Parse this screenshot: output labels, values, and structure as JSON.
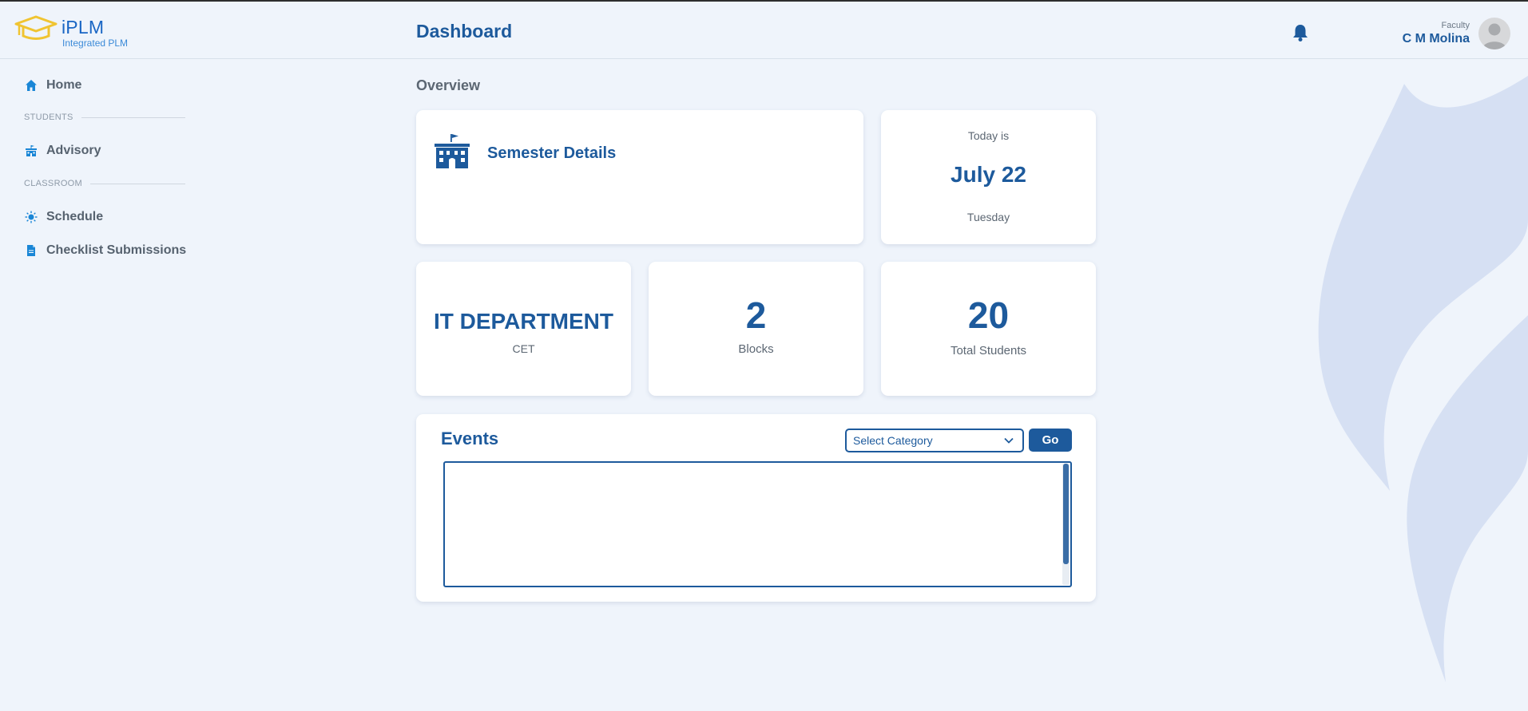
{
  "brand": {
    "name": "iPLM",
    "subtitle": "Integrated PLM"
  },
  "header": {
    "title": "Dashboard",
    "notifications_icon": "bell-icon",
    "user_role": "Faculty",
    "user_name": "C M Molina"
  },
  "sidebar": {
    "home": {
      "label": "Home",
      "icon": "home-icon"
    },
    "sections": [
      {
        "label": "STUDENTS"
      },
      {
        "label": "CLASSROOM"
      }
    ],
    "items": [
      {
        "label": "Advisory",
        "icon": "school-building-icon"
      },
      {
        "label": "Schedule",
        "icon": "bulb-icon"
      },
      {
        "label": "Checklist Submissions",
        "icon": "document-icon"
      }
    ]
  },
  "main": {
    "section_title": "Overview",
    "semester": {
      "title": "Semester Details",
      "icon": "school-building-icon"
    },
    "date": {
      "prefix": "Today is",
      "date": "July 22",
      "day": "Tuesday"
    },
    "department": {
      "name": "IT DEPARTMENT",
      "college": "CET"
    },
    "blocks": {
      "value": "2",
      "label": "Blocks"
    },
    "students": {
      "value": "20",
      "label": "Total Students"
    },
    "events": {
      "title": "Events",
      "category_select": "Select Category",
      "go_label": "Go"
    }
  },
  "colors": {
    "primary": "#1d5a9c",
    "background": "#eff4fb",
    "logo_gold": "#f0c431"
  }
}
